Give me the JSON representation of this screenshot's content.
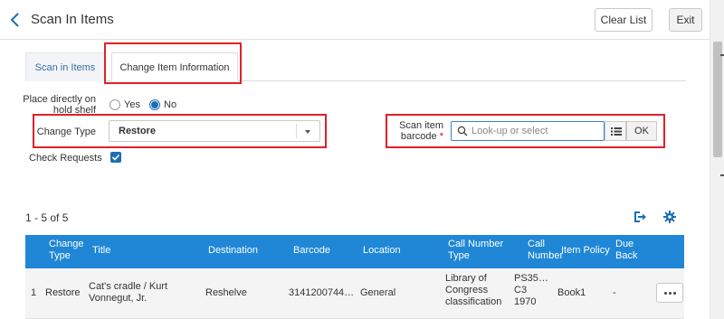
{
  "header": {
    "title": "Scan In Items",
    "clear_label": "Clear List",
    "exit_label": "Exit"
  },
  "tabs": [
    {
      "label": "Scan in Items",
      "active": false
    },
    {
      "label": "Change Item Information",
      "active": true
    }
  ],
  "form": {
    "hold_shelf_label": "Place directly on hold shelf",
    "hold_shelf_line1": "Place directly on",
    "hold_shelf_line2": "hold shelf",
    "options": [
      "Yes",
      "No"
    ],
    "selected_option": "No",
    "change_type_label": "Change Type",
    "change_type_value": "Restore",
    "check_requests_label": "Check Requests",
    "check_requests_checked": true,
    "scan_label_line1": "Scan item",
    "scan_label_line2": "barcode",
    "required_mark": "*",
    "scan_placeholder": "Look-up or select",
    "ok_label": "OK"
  },
  "results": {
    "count_text": "1 - 5 of 5",
    "columns": [
      [
        "Change",
        "Type"
      ],
      [
        "Title"
      ],
      [
        "Destination"
      ],
      [
        "Barcode"
      ],
      [
        "Location"
      ],
      [
        "Call Number",
        "Type"
      ],
      [
        "Call",
        "Number"
      ],
      [
        "Item Policy"
      ],
      [
        "Due",
        "Back"
      ]
    ],
    "rows": [
      {
        "index": "1",
        "change_type": "Restore",
        "title": [
          "Cat's cradle / Kurt",
          "Vonnegut, Jr."
        ],
        "destination": "Reshelve",
        "barcode": "3141200744…",
        "location": "General",
        "call_number_type": [
          "Library of",
          "Congress",
          "classification"
        ],
        "call_number": [
          "PS35…",
          "C3",
          "1970"
        ],
        "item_policy": "Book1",
        "due_back": "-"
      }
    ]
  },
  "colors": {
    "accent": "#1f87d6",
    "highlight_box": "#e0202a",
    "link": "#3a6ea5"
  }
}
